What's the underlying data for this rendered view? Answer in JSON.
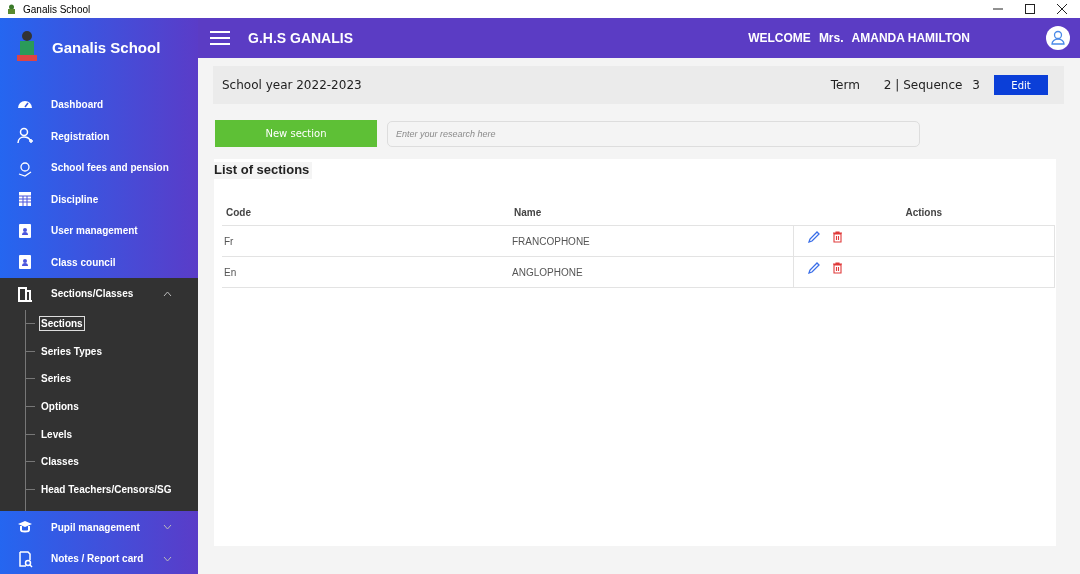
{
  "window": {
    "title": "Ganalis School"
  },
  "sidebar": {
    "brand": "Ganalis School",
    "items": [
      {
        "label": "Dashboard",
        "kind": "link"
      },
      {
        "label": "Registration",
        "kind": "link"
      },
      {
        "label": "School fees and pension",
        "kind": "link"
      },
      {
        "label": "Discipline",
        "kind": "link"
      },
      {
        "label": "User management",
        "kind": "link"
      },
      {
        "label": "Class council",
        "kind": "link"
      },
      {
        "label": "Sections/Classes",
        "kind": "group",
        "expanded": true,
        "children": [
          {
            "label": "Sections",
            "selected": true
          },
          {
            "label": "Series Types",
            "selected": false
          },
          {
            "label": "Series",
            "selected": false
          },
          {
            "label": "Options",
            "selected": false
          },
          {
            "label": "Levels",
            "selected": false
          },
          {
            "label": "Classes",
            "selected": false
          },
          {
            "label": "Head Teachers/Censors/SG",
            "selected": false
          }
        ]
      },
      {
        "label": "Pupil management",
        "kind": "group",
        "expanded": false
      },
      {
        "label": "Notes / Report card",
        "kind": "group",
        "expanded": false
      }
    ]
  },
  "header": {
    "title": "G.H.S GANALIS",
    "welcome": "WELCOME",
    "salutation": "Mrs.",
    "user": "AMANDA HAMILTON"
  },
  "year_bar": {
    "school_year": "School year 2022-2023",
    "term_label": "Term",
    "term_value": "2 | Sequence",
    "sequence_value": "3",
    "edit_button": "Edit"
  },
  "toolbar": {
    "new_button": "New section",
    "search": {
      "placeholder": "Enter your research here"
    }
  },
  "table": {
    "title": "List of sections",
    "columns": [
      "Code",
      "Name",
      "Actions"
    ],
    "rows": [
      {
        "code": "Fr",
        "name": "FRANCOPHONE"
      },
      {
        "code": "En",
        "name": "ANGLOPHONE"
      }
    ]
  }
}
